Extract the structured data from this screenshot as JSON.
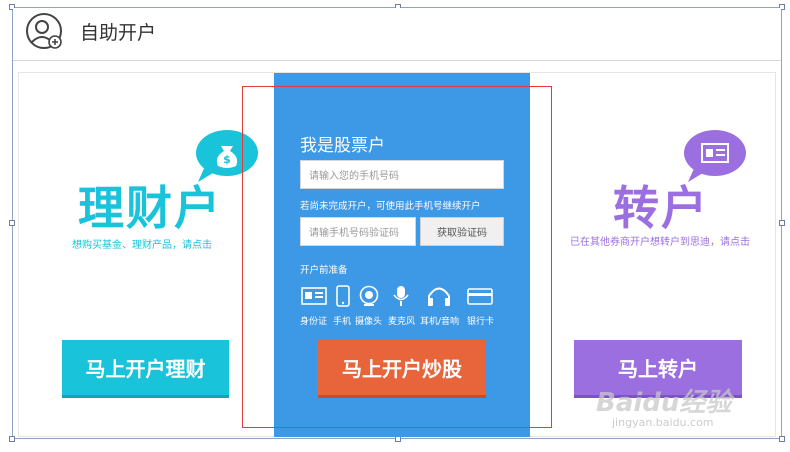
{
  "header": {
    "title": "自助开户",
    "icon": "user-add-icon"
  },
  "left": {
    "title": "理财户",
    "subtitle": "想购买基金、理财产品，请点击",
    "button": "马上开户理财",
    "color": "#19c3d9",
    "icon": "money-bag-icon"
  },
  "center": {
    "title": "我是股票户",
    "phone_placeholder": "请输入您的手机号码",
    "hint": "若尚未完成开户，可使用此手机号继续开户",
    "code_placeholder": "请输手机号码验证码",
    "code_button": "获取验证码",
    "prep_label": "开户前准备",
    "prep_items": [
      "身份证",
      "手机",
      "摄像头",
      "麦克风",
      "耳机/音响",
      "银行卡"
    ],
    "button": "马上开户炒股",
    "color": "#3d98e6",
    "button_color": "#e8643a"
  },
  "right": {
    "title": "转户",
    "subtitle": "已在其他券商开户想转户到思迪，请点击",
    "button": "马上转户",
    "color": "#9b6fe0",
    "icon": "id-card-icon"
  },
  "watermark": {
    "text": "Baidu经验",
    "sub": "jingyan.baidu.com"
  }
}
